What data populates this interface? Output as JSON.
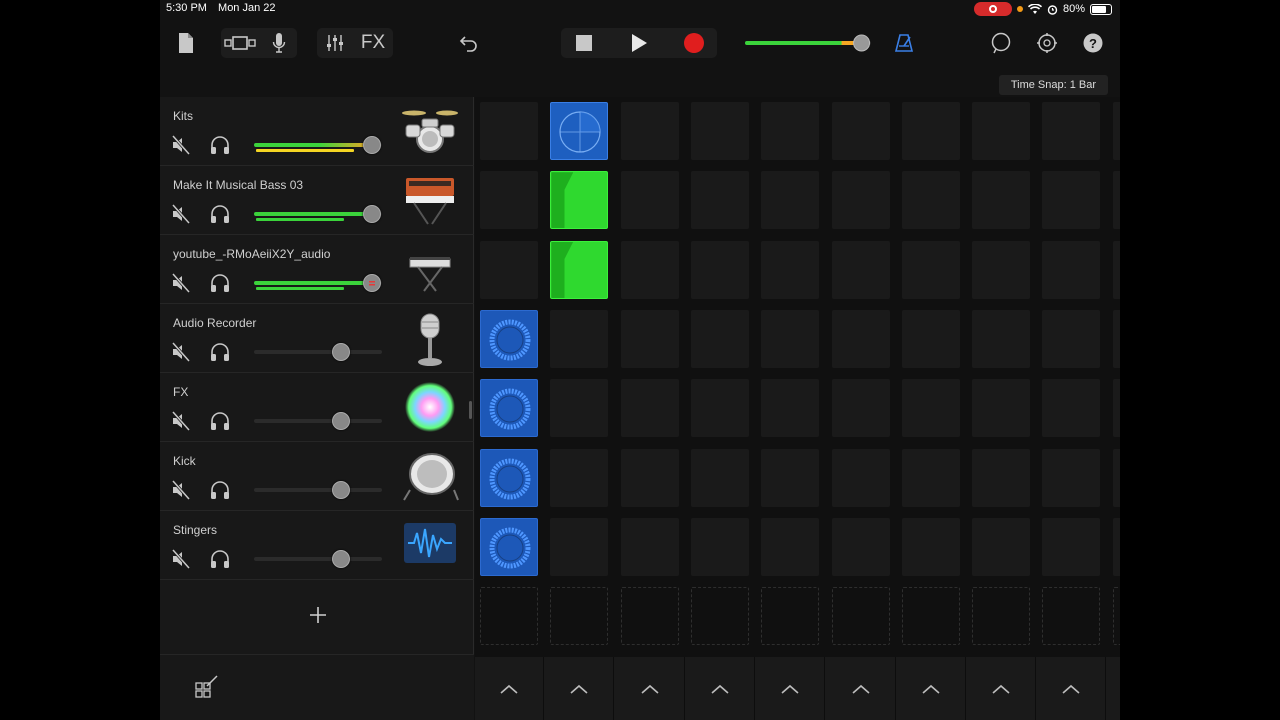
{
  "status": {
    "time": "5:30 PM",
    "date": "Mon Jan 22",
    "battery": "80%",
    "battery_level": 0.8
  },
  "toolbar": {
    "fx_label": "FX",
    "master_volume": 0.92,
    "accent": "#3a7fe6",
    "record_color": "#e01e1e"
  },
  "time_snap": "Time Snap: 1 Bar",
  "tracks": [
    {
      "name": "Kits",
      "volume": 0.92,
      "instrument_icon": "drum-kit-icon",
      "fill": "orange-gradient"
    },
    {
      "name": "Make It Musical Bass 03",
      "volume": 0.92,
      "instrument_icon": "synth-keyboard-icon",
      "fill": "green"
    },
    {
      "name": "youtube_-RMoAeiiX2Y_audio",
      "volume": 0.92,
      "instrument_icon": "keyboard-stand-icon",
      "fill": "green",
      "knob_recording": true
    },
    {
      "name": "Audio Recorder",
      "volume": 0.68,
      "instrument_icon": "microphone-icon"
    },
    {
      "name": "FX",
      "volume": 0.68,
      "instrument_icon": "sparkle-burst-icon"
    },
    {
      "name": "Kick",
      "volume": 0.68,
      "instrument_icon": "kick-drum-icon"
    },
    {
      "name": "Stingers",
      "volume": 0.68,
      "instrument_icon": "waveform-icon"
    }
  ],
  "grid": {
    "columns": 9,
    "live_cells": [
      {
        "row": 0,
        "col": 1,
        "kind": "drum-loop"
      },
      {
        "row": 1,
        "col": 1,
        "kind": "midi-loop"
      },
      {
        "row": 2,
        "col": 1,
        "kind": "midi-loop"
      },
      {
        "row": 3,
        "col": 0,
        "kind": "audio-loop"
      },
      {
        "row": 4,
        "col": 0,
        "kind": "audio-loop"
      },
      {
        "row": 5,
        "col": 0,
        "kind": "audio-loop"
      },
      {
        "row": 6,
        "col": 0,
        "kind": "audio-loop"
      }
    ]
  }
}
